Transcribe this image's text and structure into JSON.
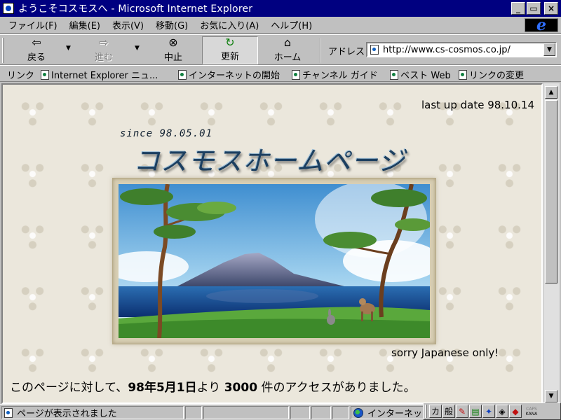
{
  "window": {
    "title": "ようこそコスモスへ - Microsoft Internet Explorer",
    "controls": {
      "minimize": "_",
      "maximize": "▭",
      "close": "×"
    }
  },
  "menu": [
    "ファイル(F)",
    "編集(E)",
    "表示(V)",
    "移動(G)",
    "お気に入り(A)",
    "ヘルプ(H)"
  ],
  "toolbar": {
    "back": "戻る",
    "forward": "進む",
    "stop": "中止",
    "refresh": "更新",
    "home": "ホーム",
    "address_label": "アドレス",
    "address_url": "http://www.cs-cosmos.co.jp/"
  },
  "links": {
    "label": "リンク",
    "items": [
      "Internet Explorer ニュ...",
      "インターネットの開始",
      "チャンネル ガイド",
      "ベスト Web",
      "リンクの変更"
    ]
  },
  "content": {
    "last_update": "last up date 98.10.14",
    "since": "since 98.05.01",
    "title": "コスモスホームページ",
    "sorry": "sorry Japanese only!",
    "access_pre": "このページに対して、",
    "access_date": "98年5月1日",
    "access_mid": "より",
    "access_count": "3000",
    "access_post": "件のアクセスがありました。"
  },
  "status": {
    "message": "ページが表示されました",
    "zone": "インターネット"
  },
  "ime": {
    "mode1": "カ",
    "mode2": "般",
    "caps": "CAPS",
    "kana": "KANA"
  },
  "colors": {
    "titlebar": "#000080",
    "chrome": "#c0c0c0",
    "page_background": "#ebe7dc",
    "title_text": "#1c3f60"
  },
  "icons": [
    "ie-logo-icon",
    "back-arrow-icon",
    "forward-arrow-icon",
    "stop-icon",
    "refresh-icon",
    "home-icon",
    "page-icon",
    "globe-icon"
  ]
}
